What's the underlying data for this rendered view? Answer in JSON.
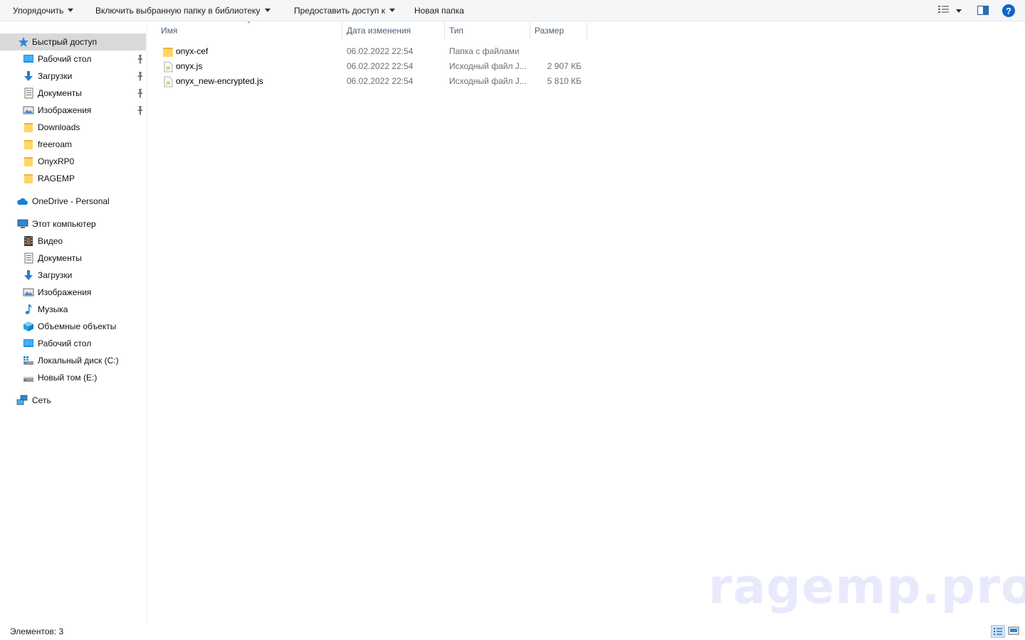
{
  "toolbar": {
    "organize": "Упорядочить",
    "include_library": "Включить выбранную папку в библиотеку",
    "share": "Предоставить доступ к",
    "new_folder": "Новая папка"
  },
  "sidebar": {
    "quick_access": "Быстрый доступ",
    "quick_items": [
      {
        "label": "Рабочий стол",
        "icon": "desktop-icon",
        "pinned": true
      },
      {
        "label": "Загрузки",
        "icon": "download-arrow-icon",
        "pinned": true
      },
      {
        "label": "Документы",
        "icon": "documents-icon",
        "pinned": true
      },
      {
        "label": "Изображения",
        "icon": "pictures-icon",
        "pinned": true
      },
      {
        "label": "Downloads",
        "icon": "folder-icon",
        "pinned": false
      },
      {
        "label": "freeroam",
        "icon": "folder-icon",
        "pinned": false
      },
      {
        "label": "OnyxRP0",
        "icon": "folder-icon",
        "pinned": false
      },
      {
        "label": "RAGEMP",
        "icon": "folder-icon",
        "pinned": false
      }
    ],
    "onedrive": "OneDrive - Personal",
    "this_pc": "Этот компьютер",
    "pc_items": [
      {
        "label": "Видео",
        "icon": "video-icon"
      },
      {
        "label": "Документы",
        "icon": "documents-icon"
      },
      {
        "label": "Загрузки",
        "icon": "download-arrow-icon"
      },
      {
        "label": "Изображения",
        "icon": "pictures-icon"
      },
      {
        "label": "Музыка",
        "icon": "music-icon"
      },
      {
        "label": "Объемные объекты",
        "icon": "3d-objects-icon"
      },
      {
        "label": "Рабочий стол",
        "icon": "desktop-icon"
      },
      {
        "label": "Локальный диск (C:)",
        "icon": "system-drive-icon"
      },
      {
        "label": "Новый том (E:)",
        "icon": "drive-icon"
      }
    ],
    "network": "Сеть"
  },
  "columns": {
    "name": "Имя",
    "date": "Дата изменения",
    "type": "Тип",
    "size": "Размер"
  },
  "files": [
    {
      "name": "onyx-cef",
      "date": "06.02.2022 22:54",
      "type": "Папка с файлами",
      "size": "",
      "icon": "folder-icon"
    },
    {
      "name": "onyx.js",
      "date": "06.02.2022 22:54",
      "type": "Исходный файл J...",
      "size": "2 907 КБ",
      "icon": "js-file-icon"
    },
    {
      "name": "onyx_new-encrypted.js",
      "date": "06.02.2022 22:54",
      "type": "Исходный файл J...",
      "size": "5 810 КБ",
      "icon": "js-file-icon"
    }
  ],
  "status": {
    "count": "Элементов: 3"
  },
  "watermark": "ragemp.pro"
}
